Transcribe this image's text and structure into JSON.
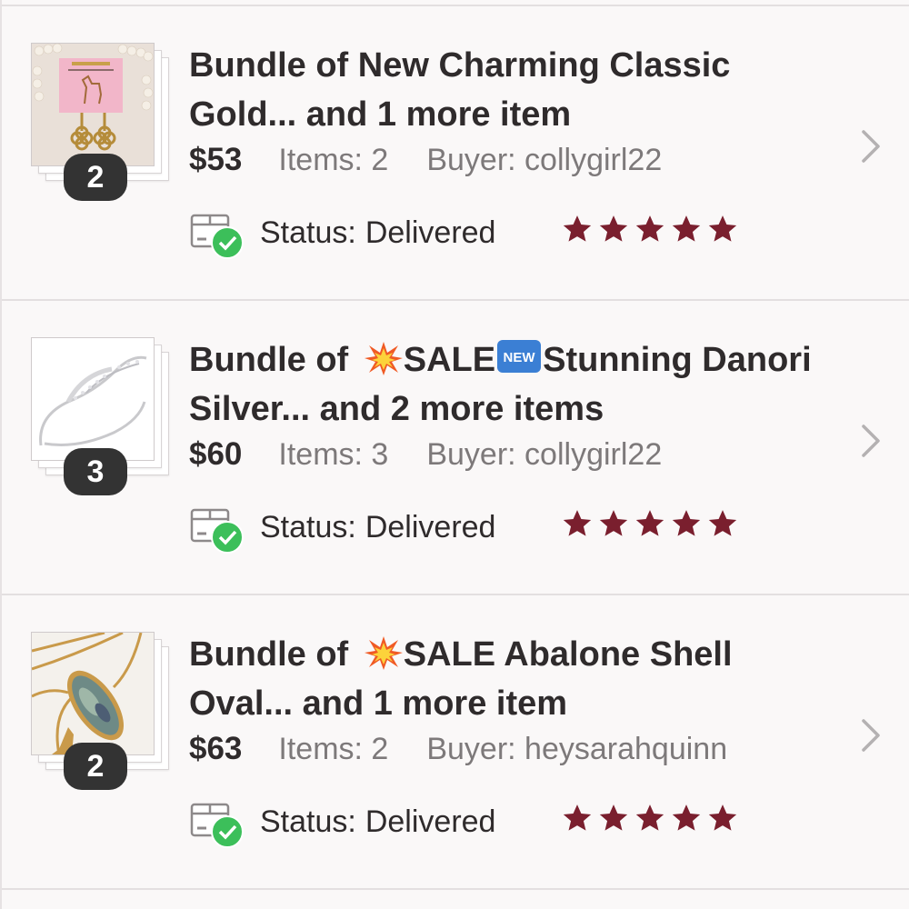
{
  "colors": {
    "star": "#7a1f2e",
    "check": "#3cbf5a",
    "badge_bg": "#333333",
    "chevron": "#b4b1b2",
    "divider": "#e3dfe0"
  },
  "orders": [
    {
      "title_line1": "Bundle of New Charming Classic",
      "title_line2": "Gold... and 1 more item",
      "price": "$53",
      "items": "Items: 2",
      "buyer": "Buyer: collygirl22",
      "status_label": "Status:",
      "status_value": "Delivered",
      "rating": 5,
      "bundle_count": "2",
      "thumbnail": "gold-earrings-image"
    },
    {
      "title_prefix": "Bundle of ",
      "title_emoji1": "collision-emoji",
      "title_mid": "SALE",
      "title_emoji2": "new-button-emoji",
      "title_rest": "Stunning Danori",
      "title_line2": "Silver... and 2 more items",
      "price": "$60",
      "items": "Items: 3",
      "buyer": "Buyer: collygirl22",
      "status_label": "Status:",
      "status_value": "Delivered",
      "rating": 5,
      "bundle_count": "3",
      "thumbnail": "silver-bangle-image"
    },
    {
      "title_prefix": "Bundle of ",
      "title_emoji1": "collision-emoji",
      "title_rest": "SALE Abalone Shell",
      "title_line2": "Oval... and 1 more item",
      "price": "$63",
      "items": "Items: 2",
      "buyer": "Buyer: heysarahquinn",
      "status_label": "Status:",
      "status_value": "Delivered",
      "rating": 5,
      "bundle_count": "2",
      "thumbnail": "abalone-necklace-image"
    }
  ]
}
